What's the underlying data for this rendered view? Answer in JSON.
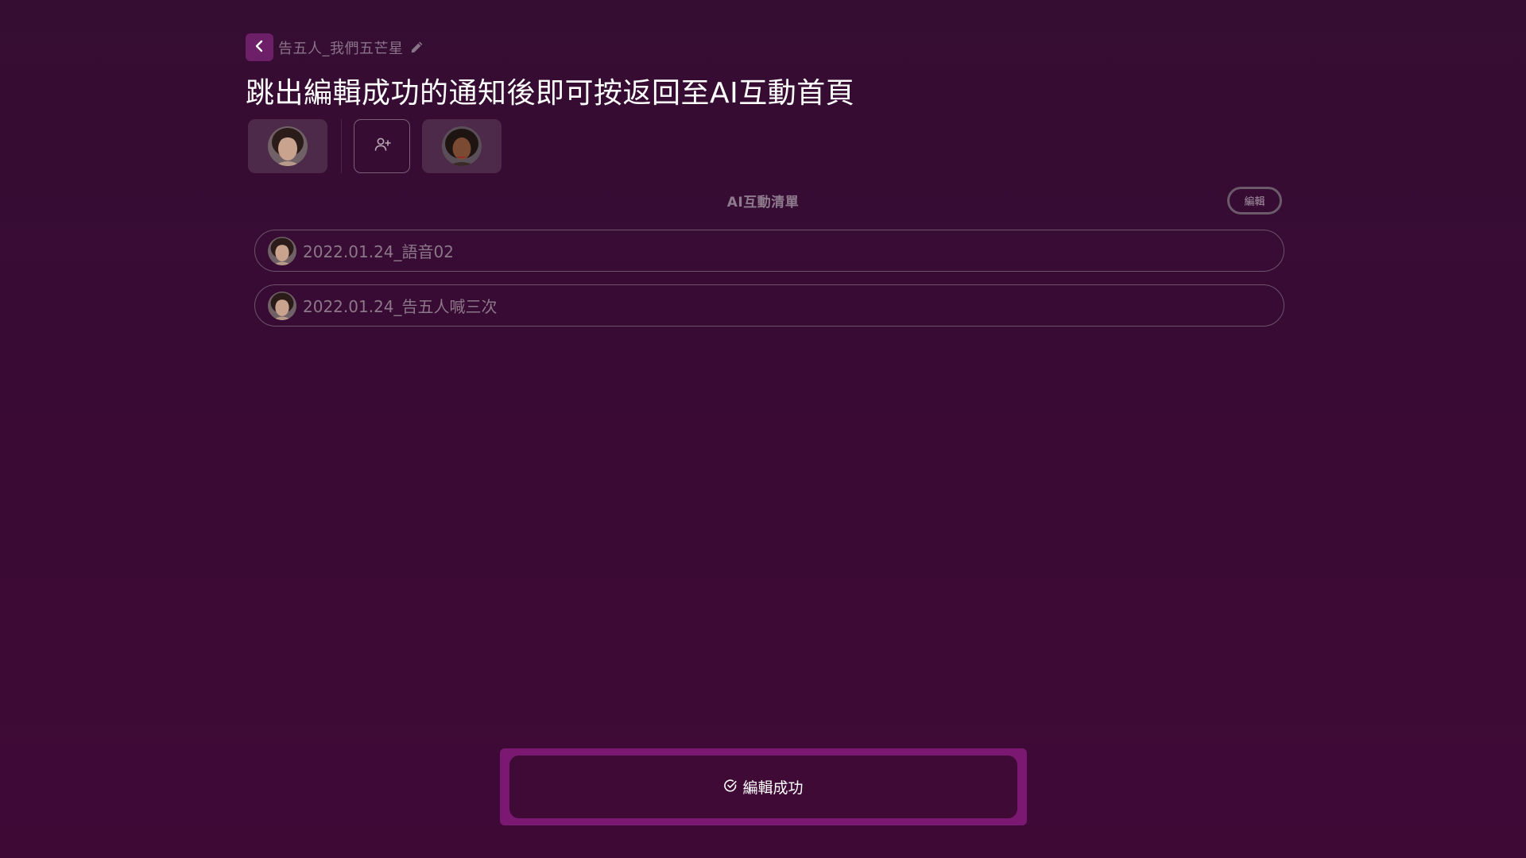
{
  "breadcrumb": {
    "title": "告五人_我們五芒星"
  },
  "page": {
    "title": "跳出編輯成功的通知後即可按返回至AI互動首頁"
  },
  "icons": {
    "back": "chevron-left-icon",
    "rename": "pencil-icon",
    "add_participant": "user-plus-icon",
    "toast": "check-circle-icon"
  },
  "section": {
    "title": "AI互動清單",
    "edit_label": "編輯"
  },
  "list": {
    "items": [
      {
        "label": "2022.01.24_語音02"
      },
      {
        "label": "2022.01.24_告五人喊三次"
      }
    ]
  },
  "toast": {
    "message": "編輯成功"
  },
  "colors": {
    "background": "#3a0a34",
    "accent": "#7b1872",
    "back_button": "#6d1f67"
  }
}
